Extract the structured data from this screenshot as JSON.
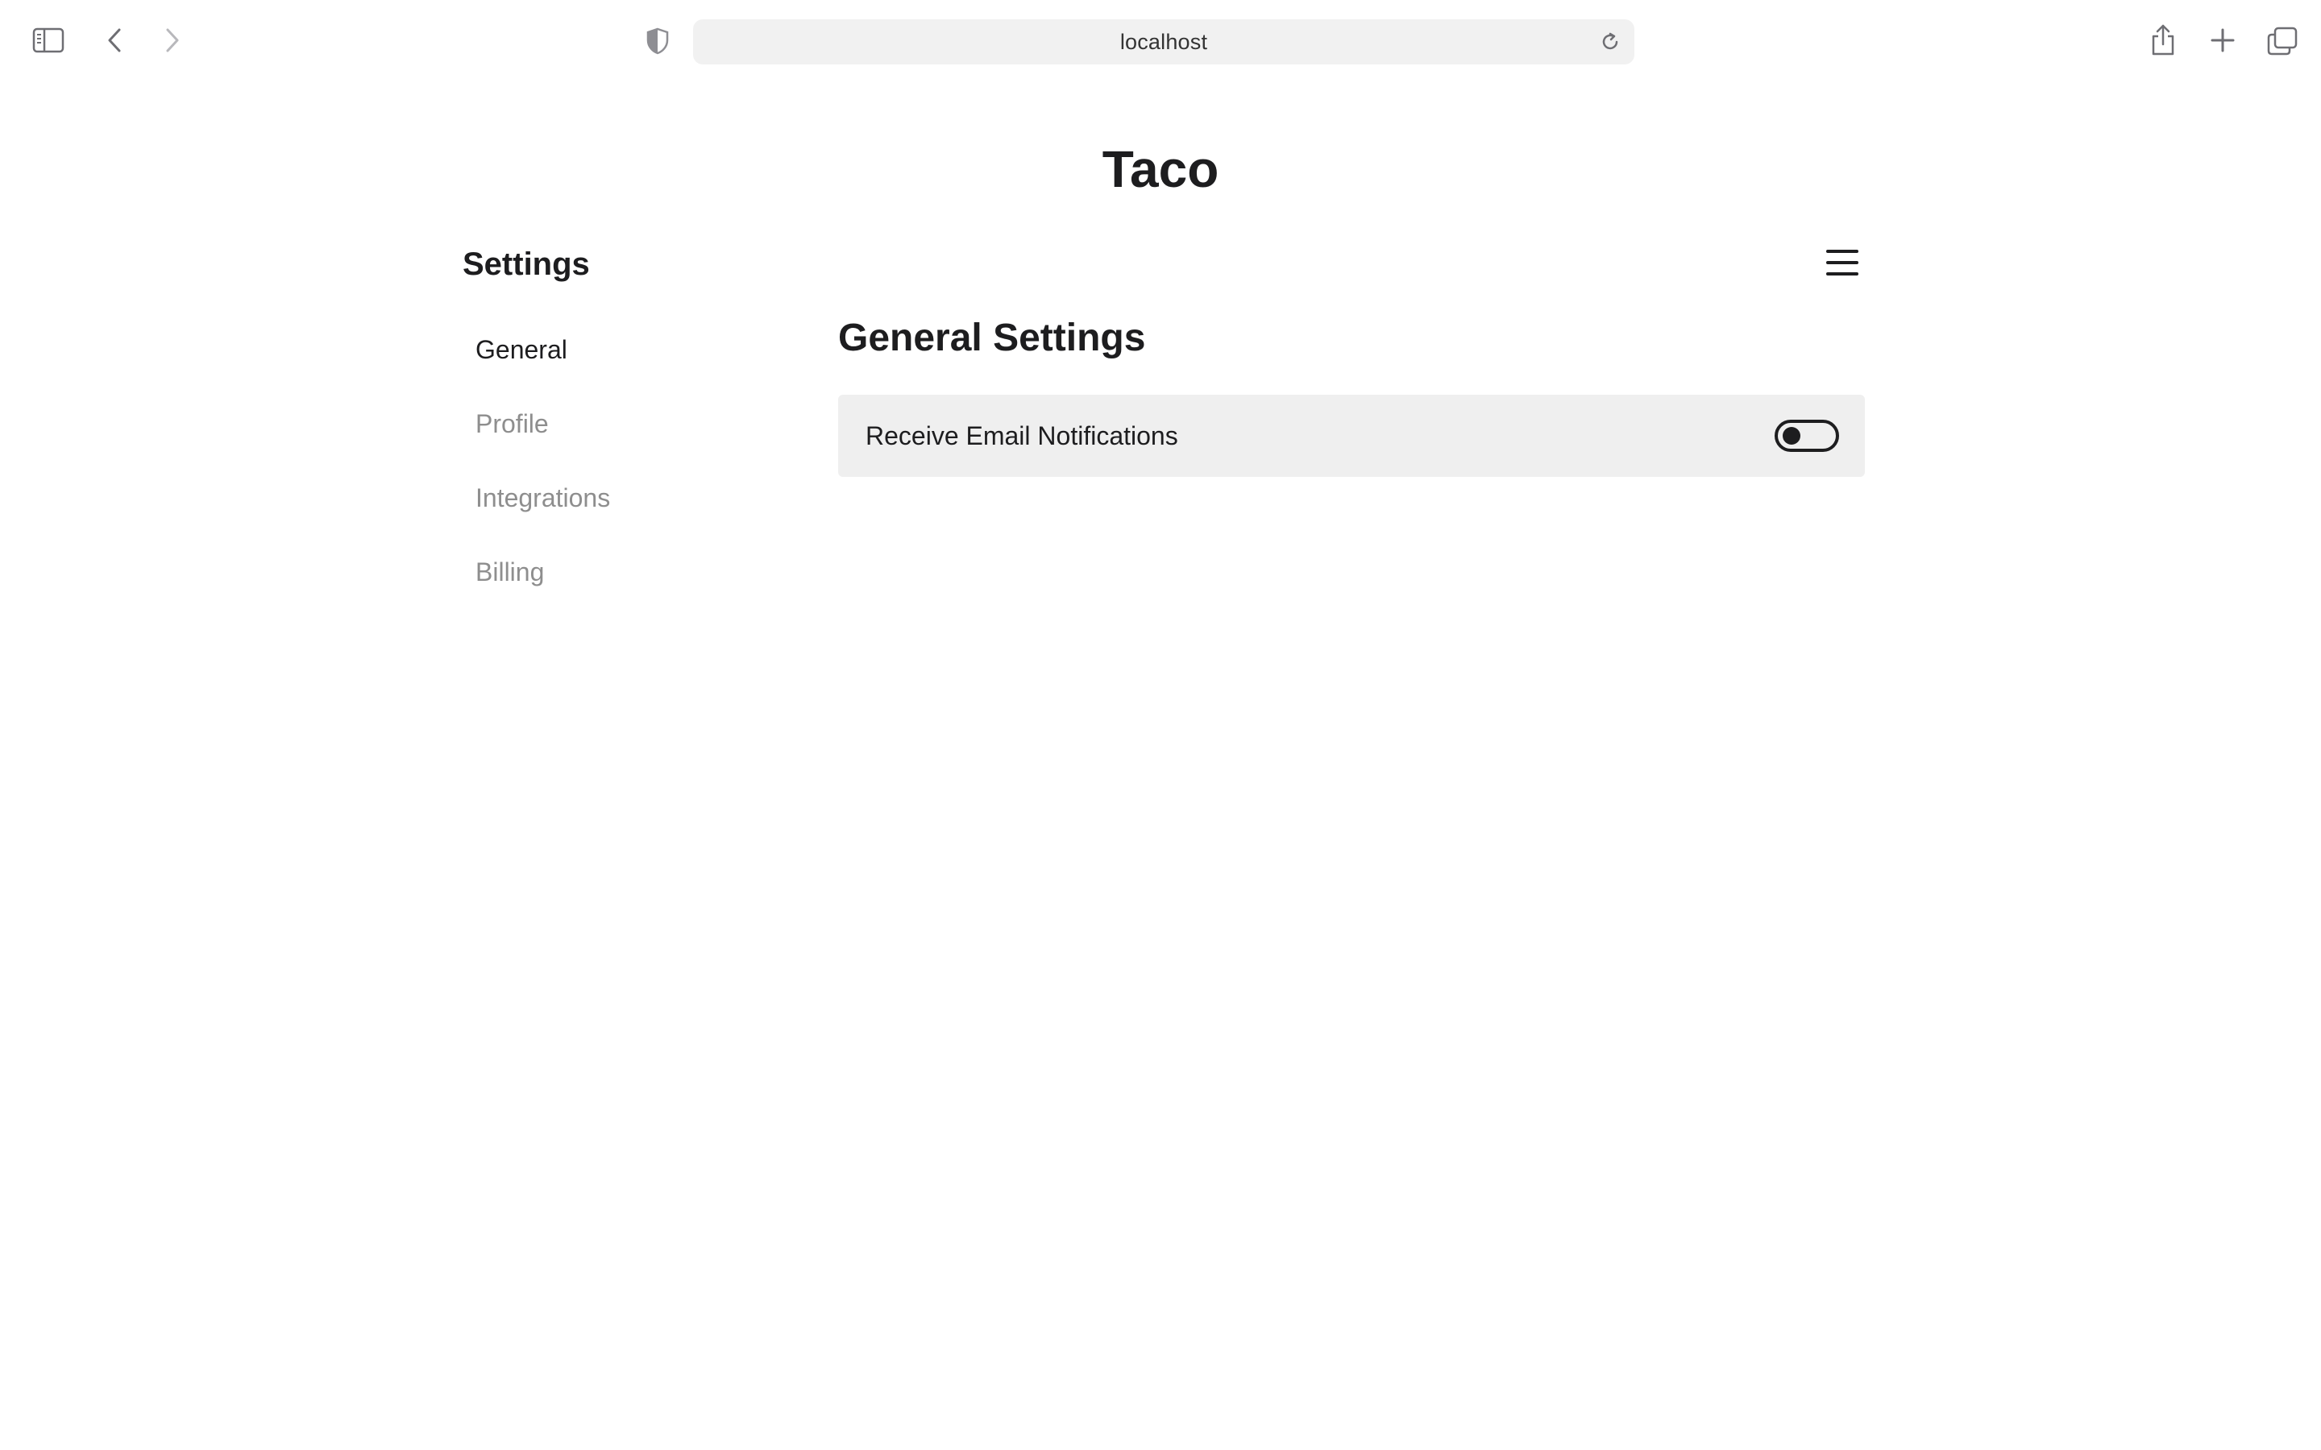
{
  "browser": {
    "address": "localhost"
  },
  "app": {
    "title": "Taco"
  },
  "sidebar": {
    "heading": "Settings",
    "items": [
      {
        "label": "General",
        "active": true
      },
      {
        "label": "Profile",
        "active": false
      },
      {
        "label": "Integrations",
        "active": false
      },
      {
        "label": "Billing",
        "active": false
      }
    ]
  },
  "main": {
    "section_title": "General Settings",
    "settings": [
      {
        "label": "Receive Email Notifications",
        "enabled": false
      }
    ]
  }
}
